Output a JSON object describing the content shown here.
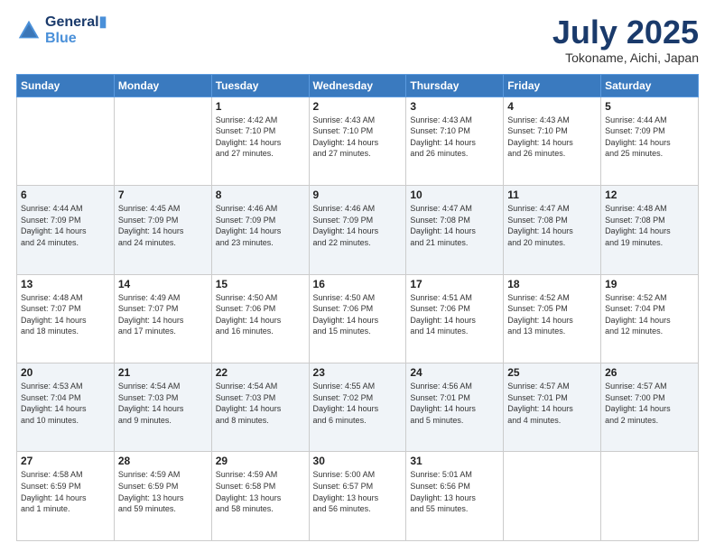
{
  "logo": {
    "line1": "General",
    "line2": "Blue"
  },
  "header": {
    "month": "July 2025",
    "location": "Tokoname, Aichi, Japan"
  },
  "weekdays": [
    "Sunday",
    "Monday",
    "Tuesday",
    "Wednesday",
    "Thursday",
    "Friday",
    "Saturday"
  ],
  "weeks": [
    [
      {
        "day": "",
        "info": ""
      },
      {
        "day": "",
        "info": ""
      },
      {
        "day": "1",
        "info": "Sunrise: 4:42 AM\nSunset: 7:10 PM\nDaylight: 14 hours\nand 27 minutes."
      },
      {
        "day": "2",
        "info": "Sunrise: 4:43 AM\nSunset: 7:10 PM\nDaylight: 14 hours\nand 27 minutes."
      },
      {
        "day": "3",
        "info": "Sunrise: 4:43 AM\nSunset: 7:10 PM\nDaylight: 14 hours\nand 26 minutes."
      },
      {
        "day": "4",
        "info": "Sunrise: 4:43 AM\nSunset: 7:10 PM\nDaylight: 14 hours\nand 26 minutes."
      },
      {
        "day": "5",
        "info": "Sunrise: 4:44 AM\nSunset: 7:09 PM\nDaylight: 14 hours\nand 25 minutes."
      }
    ],
    [
      {
        "day": "6",
        "info": "Sunrise: 4:44 AM\nSunset: 7:09 PM\nDaylight: 14 hours\nand 24 minutes."
      },
      {
        "day": "7",
        "info": "Sunrise: 4:45 AM\nSunset: 7:09 PM\nDaylight: 14 hours\nand 24 minutes."
      },
      {
        "day": "8",
        "info": "Sunrise: 4:46 AM\nSunset: 7:09 PM\nDaylight: 14 hours\nand 23 minutes."
      },
      {
        "day": "9",
        "info": "Sunrise: 4:46 AM\nSunset: 7:09 PM\nDaylight: 14 hours\nand 22 minutes."
      },
      {
        "day": "10",
        "info": "Sunrise: 4:47 AM\nSunset: 7:08 PM\nDaylight: 14 hours\nand 21 minutes."
      },
      {
        "day": "11",
        "info": "Sunrise: 4:47 AM\nSunset: 7:08 PM\nDaylight: 14 hours\nand 20 minutes."
      },
      {
        "day": "12",
        "info": "Sunrise: 4:48 AM\nSunset: 7:08 PM\nDaylight: 14 hours\nand 19 minutes."
      }
    ],
    [
      {
        "day": "13",
        "info": "Sunrise: 4:48 AM\nSunset: 7:07 PM\nDaylight: 14 hours\nand 18 minutes."
      },
      {
        "day": "14",
        "info": "Sunrise: 4:49 AM\nSunset: 7:07 PM\nDaylight: 14 hours\nand 17 minutes."
      },
      {
        "day": "15",
        "info": "Sunrise: 4:50 AM\nSunset: 7:06 PM\nDaylight: 14 hours\nand 16 minutes."
      },
      {
        "day": "16",
        "info": "Sunrise: 4:50 AM\nSunset: 7:06 PM\nDaylight: 14 hours\nand 15 minutes."
      },
      {
        "day": "17",
        "info": "Sunrise: 4:51 AM\nSunset: 7:06 PM\nDaylight: 14 hours\nand 14 minutes."
      },
      {
        "day": "18",
        "info": "Sunrise: 4:52 AM\nSunset: 7:05 PM\nDaylight: 14 hours\nand 13 minutes."
      },
      {
        "day": "19",
        "info": "Sunrise: 4:52 AM\nSunset: 7:04 PM\nDaylight: 14 hours\nand 12 minutes."
      }
    ],
    [
      {
        "day": "20",
        "info": "Sunrise: 4:53 AM\nSunset: 7:04 PM\nDaylight: 14 hours\nand 10 minutes."
      },
      {
        "day": "21",
        "info": "Sunrise: 4:54 AM\nSunset: 7:03 PM\nDaylight: 14 hours\nand 9 minutes."
      },
      {
        "day": "22",
        "info": "Sunrise: 4:54 AM\nSunset: 7:03 PM\nDaylight: 14 hours\nand 8 minutes."
      },
      {
        "day": "23",
        "info": "Sunrise: 4:55 AM\nSunset: 7:02 PM\nDaylight: 14 hours\nand 6 minutes."
      },
      {
        "day": "24",
        "info": "Sunrise: 4:56 AM\nSunset: 7:01 PM\nDaylight: 14 hours\nand 5 minutes."
      },
      {
        "day": "25",
        "info": "Sunrise: 4:57 AM\nSunset: 7:01 PM\nDaylight: 14 hours\nand 4 minutes."
      },
      {
        "day": "26",
        "info": "Sunrise: 4:57 AM\nSunset: 7:00 PM\nDaylight: 14 hours\nand 2 minutes."
      }
    ],
    [
      {
        "day": "27",
        "info": "Sunrise: 4:58 AM\nSunset: 6:59 PM\nDaylight: 14 hours\nand 1 minute."
      },
      {
        "day": "28",
        "info": "Sunrise: 4:59 AM\nSunset: 6:59 PM\nDaylight: 13 hours\nand 59 minutes."
      },
      {
        "day": "29",
        "info": "Sunrise: 4:59 AM\nSunset: 6:58 PM\nDaylight: 13 hours\nand 58 minutes."
      },
      {
        "day": "30",
        "info": "Sunrise: 5:00 AM\nSunset: 6:57 PM\nDaylight: 13 hours\nand 56 minutes."
      },
      {
        "day": "31",
        "info": "Sunrise: 5:01 AM\nSunset: 6:56 PM\nDaylight: 13 hours\nand 55 minutes."
      },
      {
        "day": "",
        "info": ""
      },
      {
        "day": "",
        "info": ""
      }
    ]
  ]
}
